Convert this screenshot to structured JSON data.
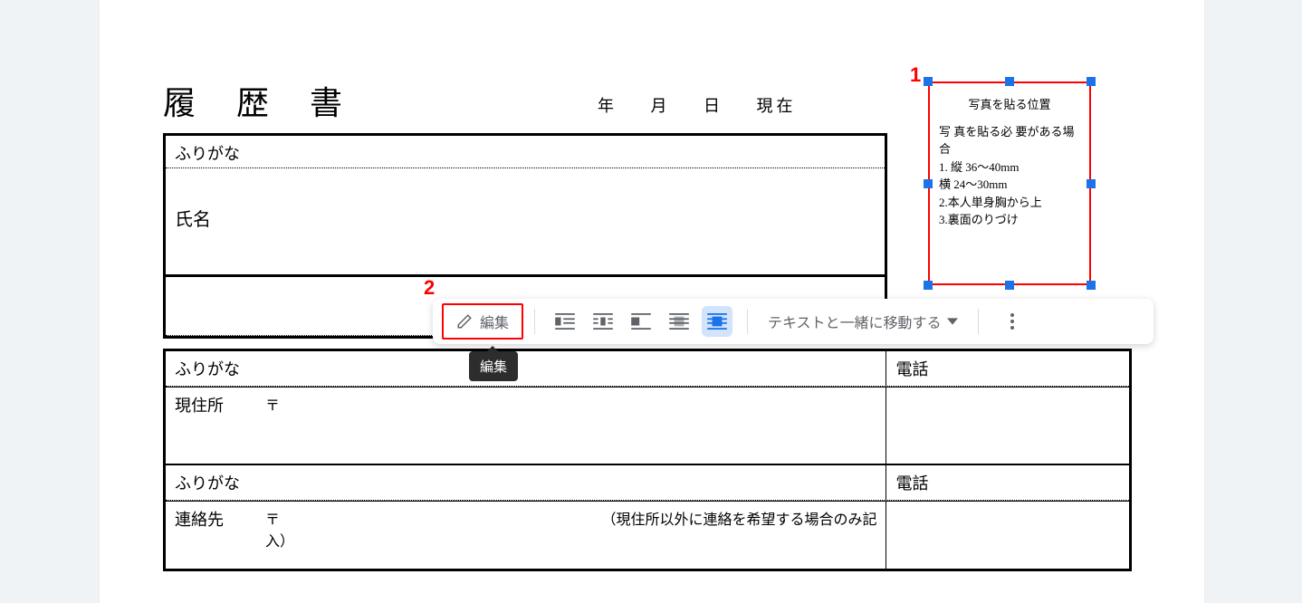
{
  "annotations": {
    "photo_marker": "1",
    "edit_marker": "2"
  },
  "document": {
    "title": "履 歴 書",
    "date": {
      "year": "年",
      "month": "月",
      "day": "日",
      "current": "現在"
    },
    "rows": {
      "furigana1": "ふりがな",
      "name_label": "氏名",
      "furigana2": "ふりがな",
      "tel2": "電話",
      "address_label": "現住所",
      "postal1": "〒",
      "furigana3": "ふりがな",
      "tel3": "電話",
      "contact_label": "連絡先",
      "postal2": "〒",
      "contact_note": "（現住所以外に連絡を希望する場合のみ記",
      "contact_note2": "入）"
    }
  },
  "photo_box": {
    "title": "写真を貼る位置",
    "lines": [
      "写 真を貼る必 要がある場合",
      "1. 縦  36〜40mm",
      "   横  24〜30mm",
      "2.本人単身胸から上",
      "3.裏面のりづけ"
    ]
  },
  "toolbar": {
    "edit_label": "編集",
    "wrap_label": "テキストと一緒に移動する",
    "tooltip": "編集"
  }
}
